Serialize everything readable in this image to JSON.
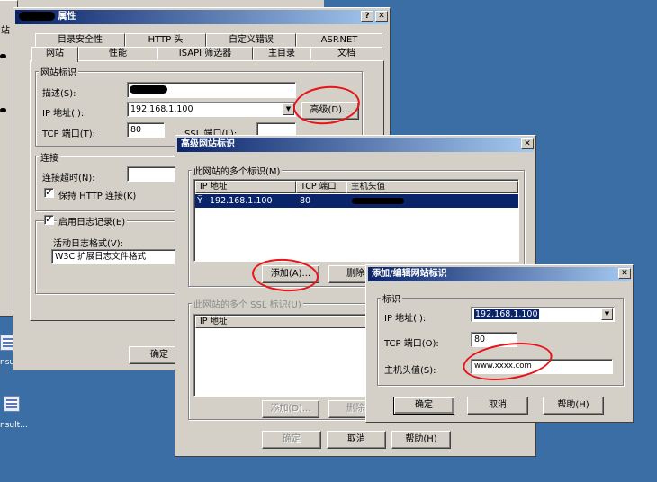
{
  "main_window": {
    "title": "属性",
    "help_btn": "?",
    "close_btn": "✕",
    "tabs_row1": [
      "目录安全性",
      "HTTP 头",
      "自定义错误",
      "ASP.NET"
    ],
    "tabs_row2": [
      "网站",
      "性能",
      "ISAPI 筛选器",
      "主目录",
      "文档"
    ],
    "group_site_id": "网站标识",
    "desc_label": "描述(S):",
    "ip_label": "IP 地址(I):",
    "ip_value": "192.168.1.100",
    "advanced_button": "高级(D)...",
    "tcp_label": "TCP 端口(T):",
    "tcp_value": "80",
    "ssl_label": "SSL 端口(L):",
    "group_connection": "连接",
    "timeout_label": "连接超时(N):",
    "keepalive_label": "保持 HTTP 连接(K)",
    "logging_label": "启用日志记录(E)",
    "log_format_label": "活动日志格式(V):",
    "log_format_value": "W3C 扩展日志文件格式",
    "ok_button": "确定"
  },
  "advanced_dialog": {
    "title": "高级网站标识",
    "close_btn": "✕",
    "group_multi": "此网站的多个标识(M)",
    "columns": [
      "IP 地址",
      "TCP 端口",
      "主机头值"
    ],
    "rows": [
      {
        "ip": "192.168.1.100",
        "port": "80"
      }
    ],
    "add_button": "添加(A)...",
    "delete_button": "删除(",
    "group_ssl": "此网站的多个 SSL 标识(U)",
    "ssl_columns": [
      "IP 地址"
    ],
    "ssl_add_button": "添加(D)...",
    "ssl_delete_button": "删除(",
    "ok_button": "确定",
    "cancel_button": "取消",
    "help_button": "帮助(H)"
  },
  "edit_dialog": {
    "title": "添加/编辑网站标识",
    "close_btn": "✕",
    "group_label": "标识",
    "ip_label": "IP 地址(I):",
    "ip_value": "192.168.1.100",
    "tcp_label": "TCP 端口(O):",
    "tcp_value": "80",
    "host_label": "主机头值(S):",
    "host_value": "www.xxxx.com",
    "ok_button": "确定",
    "cancel_button": "取消",
    "help_button": "帮助(H)"
  },
  "background_window": {
    "edge_text": "站"
  },
  "desktop": {
    "icon1_label": "nsu",
    "icon2_label": "nsult..."
  },
  "colors": {
    "desktop": "#3a6ea5",
    "titlebar": "#0a246a",
    "selection": "#0a246a",
    "annotation": "#e8141a"
  }
}
